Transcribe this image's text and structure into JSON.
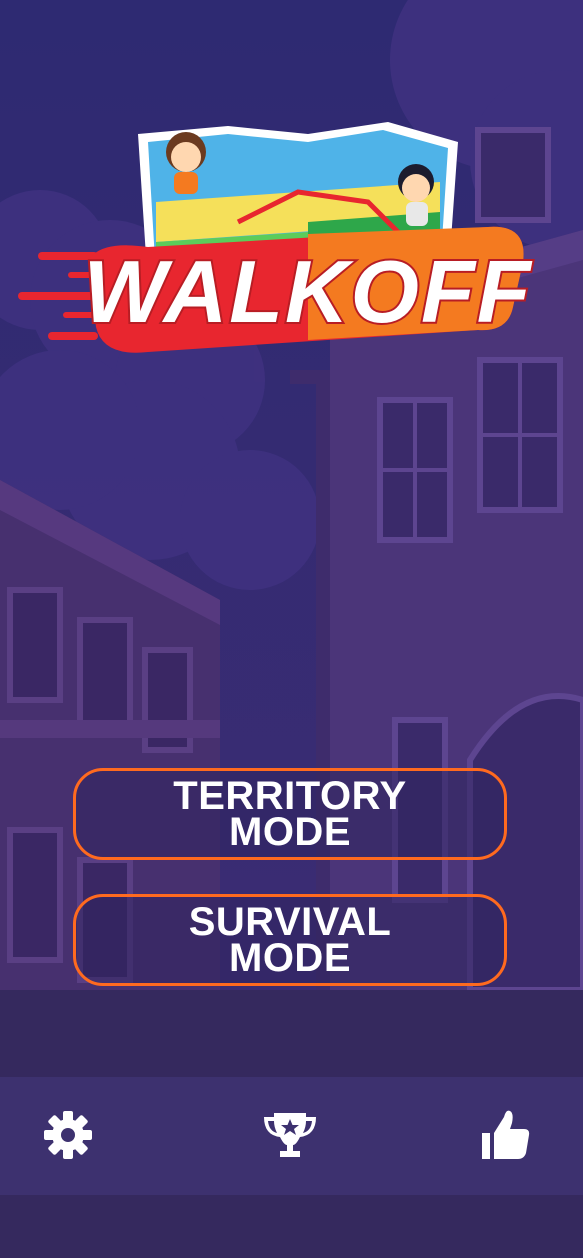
{
  "logo": {
    "text": "WALKOFF"
  },
  "modes": {
    "territory": {
      "line1": "TERRITORY",
      "line2": "MODE"
    },
    "survival": {
      "line1": "SURVIVAL",
      "line2": "MODE"
    }
  },
  "bottom_nav": {
    "items": [
      {
        "icon": "gear-icon"
      },
      {
        "icon": "trophy-icon"
      },
      {
        "icon": "thumbs-up-icon"
      }
    ]
  },
  "colors": {
    "background": "#35295e",
    "bottom_bar": "#3d316f",
    "button_border": "#ff6a1f",
    "logo_red": "#e8262f",
    "logo_orange": "#f47a20"
  }
}
